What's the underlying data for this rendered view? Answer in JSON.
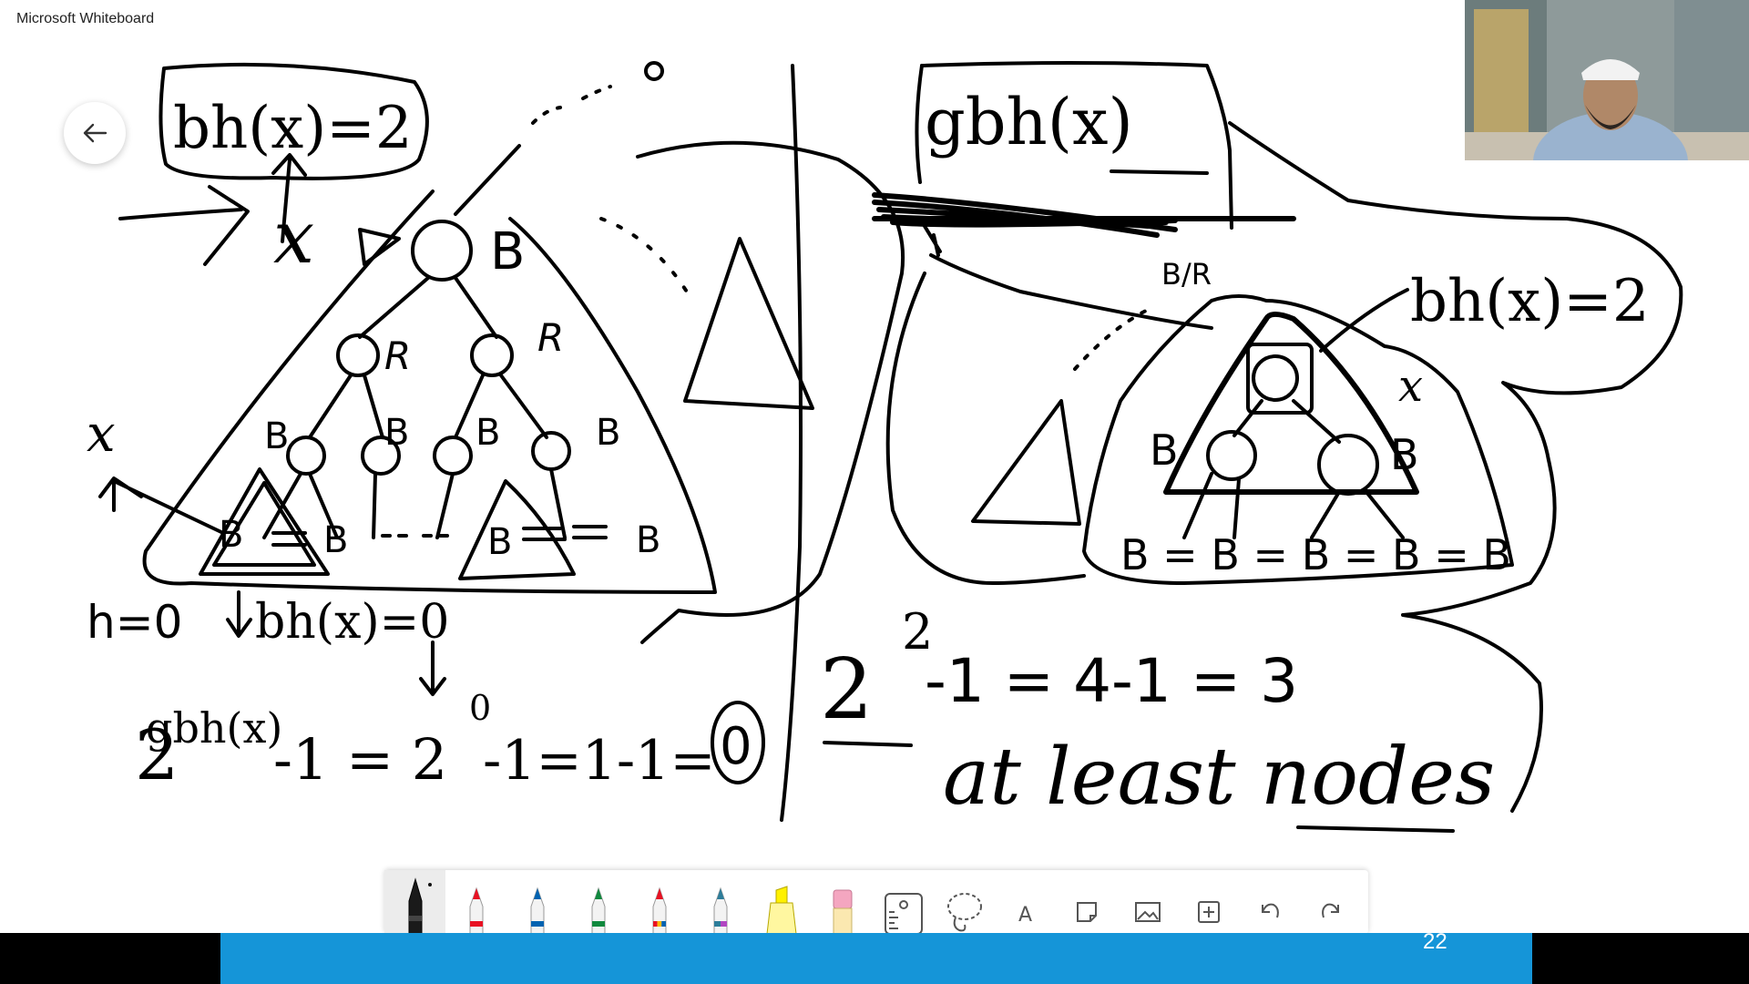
{
  "app": {
    "title": "Microsoft Whiteboard"
  },
  "navigation": {
    "back_icon": "arrow-left-icon"
  },
  "colors": {
    "ink": "#000000",
    "taskbar_blue": "#1595d8",
    "canvas": "#ffffff"
  },
  "toolbar": {
    "selected_tool": "black-pen",
    "tools": [
      {
        "name": "black-pen",
        "icon": "pen-black-icon"
      },
      {
        "name": "red-pen",
        "icon": "pen-red-icon"
      },
      {
        "name": "blue-pen",
        "icon": "pen-blue-icon"
      },
      {
        "name": "green-pen",
        "icon": "pen-green-icon"
      },
      {
        "name": "rainbow-pen",
        "icon": "pen-rainbow-icon"
      },
      {
        "name": "galaxy-pen",
        "icon": "pen-galaxy-icon"
      },
      {
        "name": "highlighter",
        "icon": "highlighter-icon"
      },
      {
        "name": "eraser",
        "icon": "eraser-icon"
      },
      {
        "name": "ruler",
        "icon": "ruler-icon"
      },
      {
        "name": "lasso",
        "icon": "lasso-icon"
      },
      {
        "name": "text",
        "icon": "text-icon",
        "label": "A"
      },
      {
        "name": "sticky-note",
        "icon": "sticky-note-icon"
      },
      {
        "name": "image",
        "icon": "image-icon"
      },
      {
        "name": "add",
        "icon": "plus-icon"
      },
      {
        "name": "undo",
        "icon": "undo-icon"
      },
      {
        "name": "redo",
        "icon": "redo-icon"
      }
    ]
  },
  "handwriting": {
    "left_box": "bh(x)=2",
    "left_x_label": "x",
    "left_root_label": "B",
    "left_r1": "R",
    "left_r2": "R",
    "left_leaf_x": "x",
    "left_b_labels": [
      "B",
      "B",
      "B",
      "B"
    ],
    "left_nil_labels": [
      "B",
      "B",
      "B",
      "B"
    ],
    "left_h_eq": "h=0",
    "left_bh_eq": "bh(x)=0",
    "left_gbh": "gbh(x)",
    "left_base": "2",
    "left_formula": "-1 = 2",
    "left_sup": "0",
    "left_formula_end": "-1=1-1=",
    "left_result": "0",
    "right_box": "gbh(x)",
    "right_br": "B/R",
    "right_bh_eq": "bh(x)=2",
    "right_x": "x",
    "right_b_left": "B",
    "right_b_right": "B",
    "right_leaves": "B = B = B = B = B",
    "right_base": "2",
    "right_sup": "2",
    "right_formula": "-1 = 4-1 = 3",
    "right_caption": "at least nodes"
  },
  "status": {
    "page_number": "22"
  }
}
